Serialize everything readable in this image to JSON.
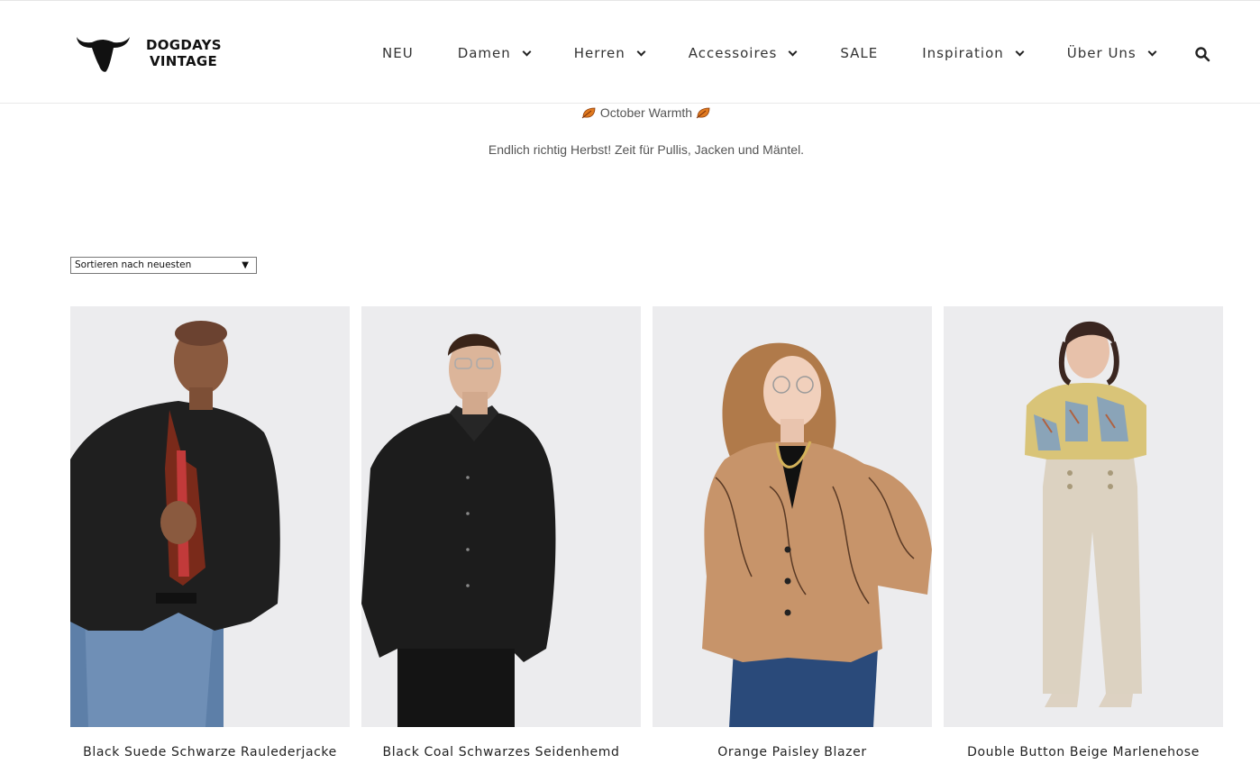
{
  "brand": {
    "line1": "DOGDAYS",
    "line2": "VINTAGE"
  },
  "nav": [
    {
      "label": "NEU",
      "dropdown": false
    },
    {
      "label": "Damen",
      "dropdown": true
    },
    {
      "label": "Herren",
      "dropdown": true
    },
    {
      "label": "Accessoires",
      "dropdown": true
    },
    {
      "label": "SALE",
      "dropdown": false
    },
    {
      "label": "Inspiration",
      "dropdown": true
    },
    {
      "label": "Über Uns",
      "dropdown": true
    }
  ],
  "banner": {
    "title": "October Warmth",
    "subtitle": "Endlich richtig Herbst! Zeit für Pullis, Jacken und Mäntel."
  },
  "sort": {
    "selected": "Sortieren nach neuesten"
  },
  "products": [
    {
      "title": "Black Suede Schwarze Raulederjacke"
    },
    {
      "title": "Black Coal Schwarzes Seidenhemd"
    },
    {
      "title": "Orange Paisley Blazer"
    },
    {
      "title": "Double Button Beige Marlenehose"
    }
  ],
  "colors": {
    "text": "#222222",
    "muted": "#555555",
    "photo_bg": "#ebebed"
  },
  "icons": [
    "bull-head-logo-icon",
    "chevron-down-icon",
    "search-icon",
    "autumn-leaf-icon"
  ]
}
